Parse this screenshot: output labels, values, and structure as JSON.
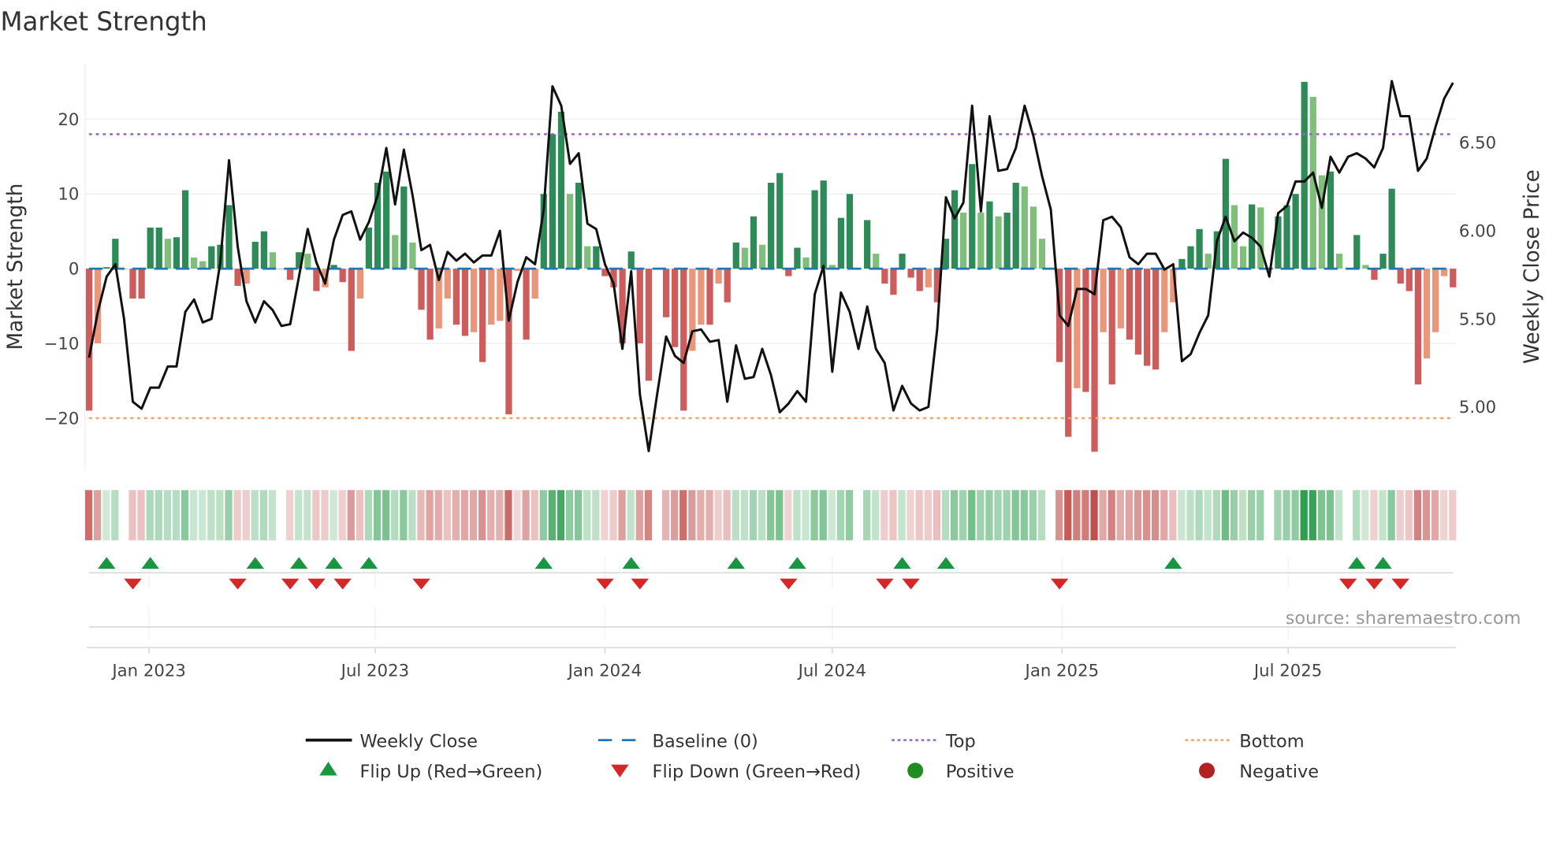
{
  "chart_data": {
    "type": "bar",
    "title": "Market Strength",
    "ylabel": "Market Strength",
    "y2label": "Weekly Close Price",
    "ylim": [
      -27,
      27
    ],
    "y2lim": [
      4.64,
      6.93
    ],
    "yticks": [
      20,
      10,
      0,
      -10,
      -20
    ],
    "ytick_labels": [
      "20",
      "10",
      "0",
      "−10",
      "−20"
    ],
    "y2ticks": [
      6.5,
      6.0,
      5.5,
      5.0
    ],
    "y2tick_labels": [
      "6.50",
      "6.00",
      "5.50",
      "5.00"
    ],
    "xticks": [
      "2023-01-01",
      "2023-07-01",
      "2024-01-01",
      "2024-07-01",
      "2025-01-01",
      "2025-07-01"
    ],
    "xtick_labels": [
      "Jan 2023",
      "Jul 2023",
      "Jan 2024",
      "Jul 2024",
      "Jan 2025",
      "Jul 2025"
    ],
    "start_date": "2022-11-14",
    "frequency": "weekly",
    "top_level": 18,
    "bottom_level": -20,
    "baseline": 0,
    "strength": [
      -19,
      -10,
      0.2,
      4,
      0,
      -4,
      -4,
      5.5,
      5.5,
      4,
      4.2,
      10.5,
      1.5,
      1,
      3,
      3.2,
      8.5,
      -2.3,
      -2,
      3.6,
      5,
      2.2,
      0,
      -1.5,
      2.2,
      2,
      -3,
      -2.5,
      0.5,
      -1.8,
      -11,
      -4,
      5.5,
      11.5,
      13,
      4.5,
      11,
      3.5,
      -5.5,
      -9.5,
      -8,
      -4,
      -7.5,
      -9,
      -8.5,
      -12.5,
      -7.5,
      -7,
      -19.5,
      -0.3,
      -9.5,
      -4,
      10,
      18,
      21,
      10,
      11.5,
      3,
      3,
      -1,
      -2.5,
      -10,
      2.3,
      -10,
      -15,
      0,
      -6.5,
      -10.5,
      -19,
      -11,
      -7.5,
      -7.5,
      -2,
      -4.5,
      3.5,
      2.8,
      7,
      3.2,
      11.5,
      12.8,
      -1,
      2.8,
      1.5,
      10.5,
      11.8,
      0.5,
      6.8,
      10,
      0,
      6.5,
      2,
      -2,
      -3.5,
      2,
      -1.2,
      -3,
      -2.5,
      -4.5,
      4,
      10.5,
      7.5,
      14,
      7.5,
      9,
      7,
      7.5,
      11.5,
      11,
      8.3,
      4,
      0,
      -12.5,
      -22.5,
      -16,
      -16.5,
      -24.5,
      -8.5,
      -15.5,
      -8,
      -9.5,
      -11.5,
      -13,
      -13.5,
      -8.5,
      -4.5,
      1.3,
      3,
      5.3,
      2,
      5,
      14.7,
      8.5,
      3,
      8.6,
      8.2,
      0,
      7,
      8.5,
      10,
      25,
      23,
      12.5,
      13,
      2,
      0,
      4.5,
      0.5,
      -1.5,
      2,
      10.7,
      -2,
      -3,
      -15.5,
      -12,
      -8.5,
      -1,
      -2.5
    ],
    "close": [
      5.28,
      5.54,
      5.74,
      5.81,
      5.5,
      5.03,
      4.99,
      5.11,
      5.11,
      5.23,
      5.23,
      5.54,
      5.61,
      5.48,
      5.5,
      5.82,
      6.4,
      5.91,
      5.6,
      5.48,
      5.6,
      5.55,
      5.46,
      5.47,
      5.74,
      6.01,
      5.82,
      5.7,
      5.95,
      6.09,
      6.11,
      5.95,
      6.05,
      6.2,
      6.47,
      6.15,
      6.46,
      6.2,
      5.89,
      5.92,
      5.72,
      5.88,
      5.83,
      5.87,
      5.82,
      5.86,
      5.86,
      6.0,
      5.49,
      5.71,
      5.85,
      5.81,
      6.12,
      6.82,
      6.71,
      6.38,
      6.44,
      6.04,
      6.01,
      5.81,
      5.7,
      5.33,
      5.77,
      5.07,
      4.75,
      5.08,
      5.4,
      5.29,
      5.25,
      5.43,
      5.44,
      5.37,
      5.38,
      5.03,
      5.35,
      5.16,
      5.17,
      5.33,
      5.18,
      4.97,
      5.02,
      5.09,
      5.03,
      5.64,
      5.8,
      5.2,
      5.65,
      5.54,
      5.33,
      5.57,
      5.33,
      5.25,
      4.98,
      5.12,
      5.02,
      4.98,
      5.0,
      5.44,
      6.19,
      6.07,
      6.16,
      6.71,
      6.11,
      6.65,
      6.34,
      6.35,
      6.47,
      6.71,
      6.54,
      6.31,
      6.12,
      5.52,
      5.46,
      5.67,
      5.67,
      5.64,
      6.06,
      6.08,
      6.02,
      5.85,
      5.81,
      5.87,
      5.87,
      5.78,
      5.81,
      5.26,
      5.3,
      5.42,
      5.52,
      5.94,
      6.08,
      5.94,
      5.99,
      5.96,
      5.91,
      5.74,
      6.1,
      6.14,
      6.28,
      6.28,
      6.33,
      6.13,
      6.42,
      6.33,
      6.42,
      6.44,
      6.41,
      6.36,
      6.47,
      6.85,
      6.65,
      6.65,
      6.34,
      6.41,
      6.59,
      6.75,
      6.84
    ],
    "flip_up_weeks": [
      2,
      7,
      19,
      24,
      28,
      32,
      52,
      62,
      74,
      81,
      93,
      98,
      124,
      145,
      148
    ],
    "flip_down_weeks": [
      5,
      17,
      23,
      26,
      29,
      38,
      59,
      63,
      80,
      91,
      94,
      111,
      144,
      147,
      150
    ],
    "legend": {
      "placement": "bottom",
      "items": [
        "Weekly Close",
        "Baseline (0)",
        "Top",
        "Bottom",
        "Flip Up (Red→Green)",
        "Flip Down (Green→Red)",
        "Positive",
        "Negative"
      ]
    },
    "source": "source: sharemaestro.com"
  },
  "colors": {
    "pos_strong": "#2e8b57",
    "pos_weak": "#7fbf7b",
    "neg_strong": "#cd5c5c",
    "neg_weak": "#e9967a",
    "line": "#111111",
    "baseline": "#1f77b4",
    "top": "#9467bd",
    "bottom": "#f4a460",
    "flip_up": "#1a9641",
    "flip_down": "#d62728",
    "positive": "#228b22",
    "negative": "#b22222"
  }
}
